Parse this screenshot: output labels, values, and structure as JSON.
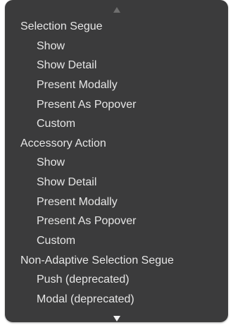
{
  "menu": {
    "scroll_up_icon": "triangle-up",
    "scroll_down_icon": "triangle-down",
    "sections": [
      {
        "label": "Selection Segue",
        "items": [
          "Show",
          "Show Detail",
          "Present Modally",
          "Present As Popover",
          "Custom"
        ]
      },
      {
        "label": "Accessory Action",
        "items": [
          "Show",
          "Show Detail",
          "Present Modally",
          "Present As Popover",
          "Custom"
        ]
      },
      {
        "label": "Non-Adaptive Selection Segue",
        "items": [
          "Push (deprecated)",
          "Modal (deprecated)"
        ]
      }
    ]
  },
  "colors": {
    "menu_background": "#3b3b3c",
    "text": "#e6e6e6",
    "arrow": "#8a8a8a"
  }
}
